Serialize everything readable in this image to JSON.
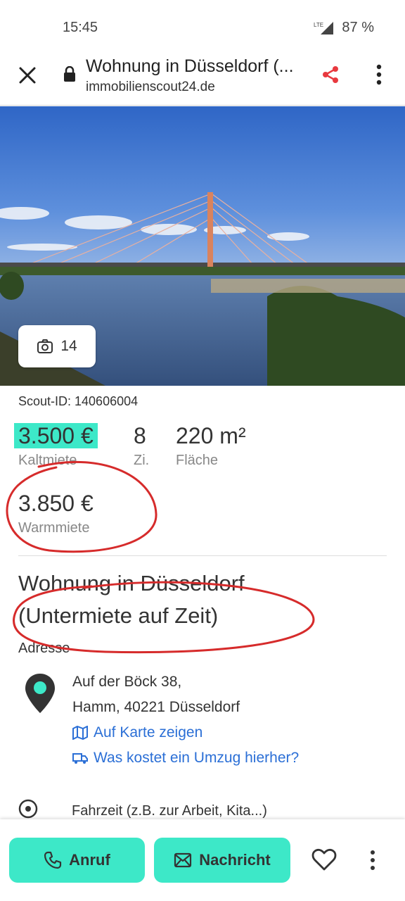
{
  "status_bar": {
    "time": "15:45",
    "network": "LTE",
    "battery": "87 %"
  },
  "browser": {
    "title": "Wohnung in Düsseldorf (...",
    "domain": "immobilienscout24.de",
    "icons": [
      "close-icon",
      "lock-icon",
      "share-icon",
      "more-vertical-icon"
    ]
  },
  "hero": {
    "photo_count": "14"
  },
  "listing": {
    "scout_id": "Scout-ID: 140606004",
    "cold_rent": {
      "value": "3.500 €",
      "label": "Kaltmiete"
    },
    "rooms": {
      "value": "8",
      "label": "Zi."
    },
    "area": {
      "value": "220 m²",
      "label": "Fläche"
    },
    "warm_rent": {
      "value": "3.850 €",
      "label": "Warmmiete"
    },
    "title_line1": "Wohnung in Düsseldorf",
    "title_line2": "(Untermiete auf Zeit)"
  },
  "address": {
    "heading": "Adresse",
    "street": "Auf der Böck 38,",
    "city": "Hamm, 40221 Düsseldorf",
    "map_link": "Auf Karte zeigen",
    "moving_link": "Was kostet ein Umzug hierher?"
  },
  "travel": {
    "text": "Fahrzeit (z.B. zur Arbeit, Kita...)"
  },
  "bottom_bar": {
    "call_label": "Anruf",
    "message_label": "Nachricht"
  },
  "colors": {
    "accent": "#3de8c8",
    "link": "#2b6fd6",
    "share": "#e8393f",
    "annotation": "#d62b2b"
  }
}
